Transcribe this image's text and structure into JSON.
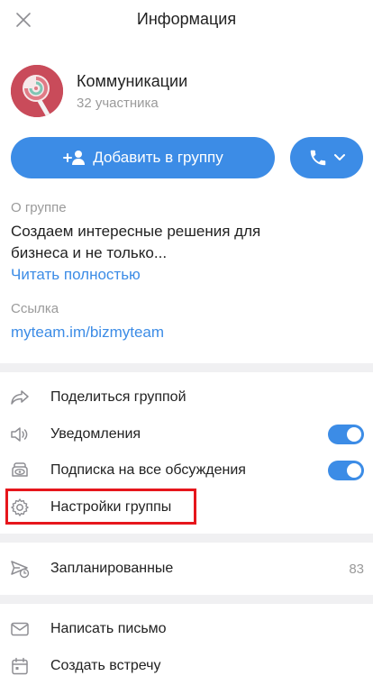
{
  "header": {
    "title": "Информация",
    "close_icon": "close-icon"
  },
  "group": {
    "name": "Коммуникации",
    "members": "32 участника",
    "avatar_icon": "lollipop-avatar"
  },
  "actions": {
    "add_label": "Добавить в группу",
    "add_icon": "add-user-icon",
    "call_icon": "phone-icon"
  },
  "about": {
    "caption": "О группе",
    "text": "Создаем интересные решения для бизнеса и не только...",
    "read_more": "Читать полностью",
    "link_caption": "Ссылка",
    "link_value": "myteam.im/bizmyteam"
  },
  "menu": {
    "share": {
      "label": "Поделиться группой",
      "icon": "share-icon"
    },
    "notifications": {
      "label": "Уведомления",
      "icon": "speaker-icon",
      "enabled": true
    },
    "subscribe": {
      "label": "Подписка на все обсуждения",
      "icon": "eye-icon",
      "enabled": true
    },
    "settings": {
      "label": "Настройки группы",
      "icon": "gear-icon"
    },
    "scheduled": {
      "label": "Запланированные",
      "icon": "send-clock-icon",
      "count": "83"
    },
    "email": {
      "label": "Написать письмо",
      "icon": "envelope-icon"
    },
    "meeting": {
      "label": "Создать встречу",
      "icon": "calendar-icon"
    }
  },
  "colors": {
    "accent": "#3c8ce6",
    "highlight": "#e6161c",
    "separator": "#f0f0f2"
  }
}
